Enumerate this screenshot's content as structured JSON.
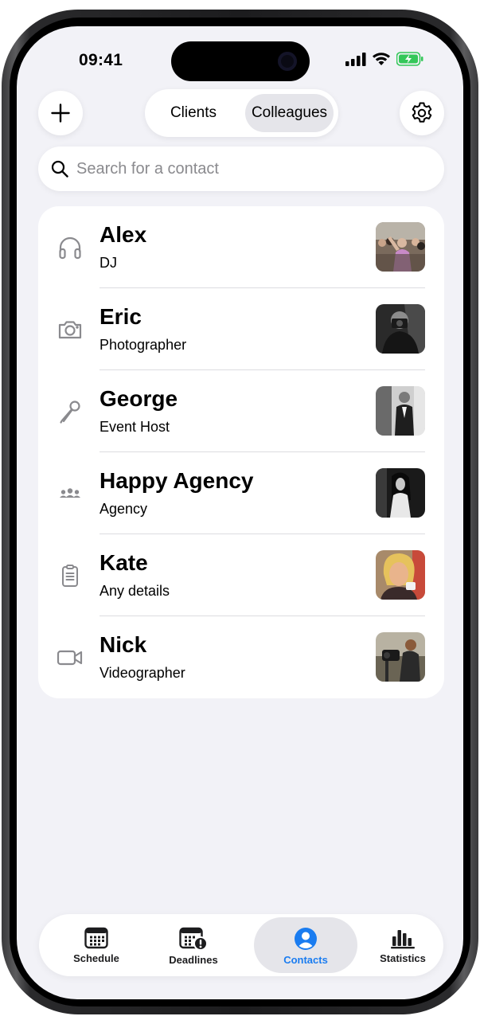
{
  "status_bar": {
    "time": "09:41"
  },
  "header": {
    "segments": [
      {
        "label": "Clients",
        "selected": false
      },
      {
        "label": "Colleagues",
        "selected": true
      }
    ]
  },
  "search": {
    "placeholder": "Search for a contact",
    "value": ""
  },
  "contacts": [
    {
      "name": "Alex",
      "role": "DJ",
      "icon": "headphones-icon"
    },
    {
      "name": "Eric",
      "role": "Photographer",
      "icon": "camera-icon"
    },
    {
      "name": "George",
      "role": "Event Host",
      "icon": "microphone-icon"
    },
    {
      "name": "Happy Agency",
      "role": "Agency",
      "icon": "people-group-icon"
    },
    {
      "name": "Kate",
      "role": "Any details",
      "icon": "clipboard-icon"
    },
    {
      "name": "Nick",
      "role": "Videographer",
      "icon": "video-camera-icon"
    }
  ],
  "tabbar": {
    "tabs": [
      {
        "label": "Schedule",
        "icon": "calendar-icon",
        "active": false
      },
      {
        "label": "Deadlines",
        "icon": "calendar-alert-icon",
        "active": false
      },
      {
        "label": "Contacts",
        "icon": "person-circle-icon",
        "active": true
      },
      {
        "label": "Statistics",
        "icon": "bar-chart-icon",
        "active": false
      }
    ]
  },
  "colors": {
    "background": "#f2f2f7",
    "accent": "#1a7cf0",
    "battery": "#34c759",
    "secondary_icon": "#8a8a8e"
  }
}
